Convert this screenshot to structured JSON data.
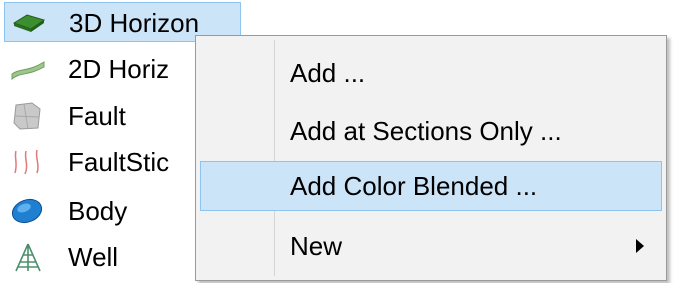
{
  "tree": {
    "items": [
      {
        "label": "3D Horizon",
        "icon": "3d-horizon-icon"
      },
      {
        "label": "2D Horiz",
        "icon": "2d-horizon-icon"
      },
      {
        "label": "Fault",
        "icon": "fault-icon"
      },
      {
        "label": "FaultStic",
        "icon": "faultstick-icon"
      },
      {
        "label": "Body",
        "icon": "body-icon"
      },
      {
        "label": "Well",
        "icon": "well-icon"
      }
    ]
  },
  "context_menu": {
    "items": [
      {
        "label": "Add ..."
      },
      {
        "label": "Add at Sections Only ..."
      },
      {
        "label": "Add Color Blended ..."
      },
      {
        "label": "New"
      }
    ]
  },
  "colors": {
    "selection_bg": "#cce4f7",
    "selection_border": "#8ec5f0",
    "menu_bg": "#f2f2f2"
  }
}
